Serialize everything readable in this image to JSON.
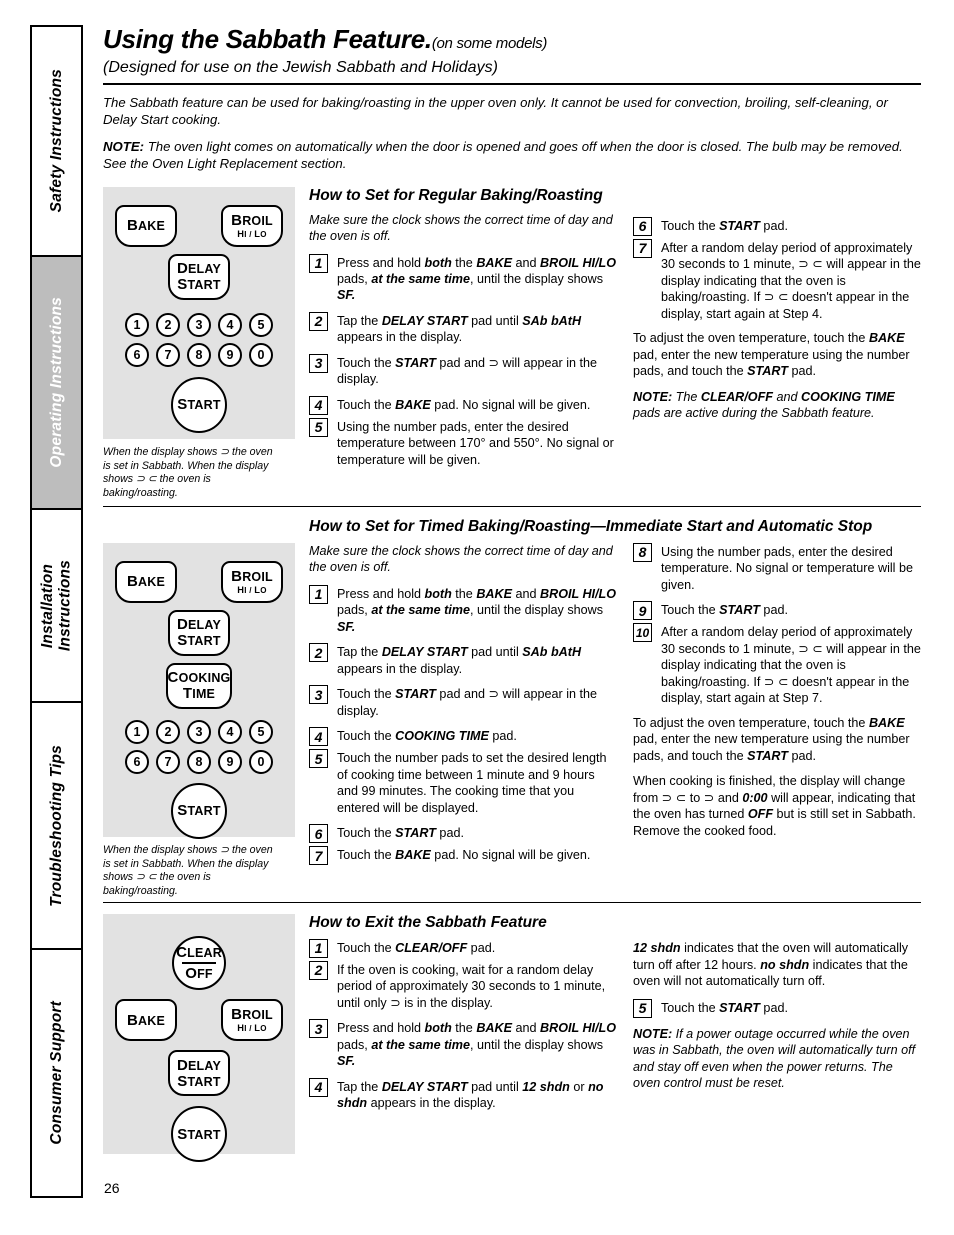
{
  "page_number": "26",
  "sidebar": {
    "tabs": [
      {
        "label": "Safety Instructions",
        "active": false
      },
      {
        "label": "Operating Instructions",
        "active": true
      },
      {
        "label": "Installation\nInstructions",
        "active": false
      },
      {
        "label": "Troubleshooting Tips",
        "active": false
      },
      {
        "label": "Consumer Support",
        "active": false
      }
    ]
  },
  "header": {
    "title": "Using the Sabbath Feature.",
    "title_note": "(on some models)",
    "subtitle": "(Designed for use on the Jewish Sabbath and Holidays)",
    "intro": "The Sabbath feature can be used for baking/roasting in the upper oven only. It cannot be used for convection, broiling, self-cleaning, or Delay Start cooking.",
    "note_label": "NOTE:",
    "note_text": " The oven light comes on automatically when the door is opened and goes off when the door is closed. The bulb may be removed. See the Oven Light Replacement section."
  },
  "diagram_labels": {
    "bake": "Bake",
    "broil": "Broil",
    "broil_sub": "Hi / Lo",
    "delay": "Delay",
    "start_word": "Start",
    "cooking": "Cooking",
    "time": "Time",
    "clear": "Clear",
    "off": "Off",
    "start": "Start",
    "keys_row1": [
      "1",
      "2",
      "3",
      "4",
      "5"
    ],
    "keys_row2": [
      "6",
      "7",
      "8",
      "9",
      "0"
    ]
  },
  "caption": "When the display shows ⊃ the oven is set in Sabbath. When the display shows ⊃ ⊂  the oven is baking/roasting.",
  "section1": {
    "heading": "How to Set for Regular Baking/Roasting",
    "lead": "Make sure the clock shows the correct time of day and the oven is off.",
    "steps": [
      {
        "n": "1",
        "text": "Press and hold <b>both</b> the <b>BAKE</b> and <b>BROIL HI/LO</b> pads, <b>at the same time</b>, until the display shows <b>SF.</b>"
      },
      {
        "n": "2",
        "text": "Tap the <b>DELAY START</b> pad until <b>SAb bAtH</b> appears in the display."
      },
      {
        "n": "3",
        "text": "Touch the <b>START</b> pad and ⊃ will appear in the display."
      },
      {
        "n": "4",
        "text": "Touch the <b>BAKE</b> pad. No signal will be given."
      },
      {
        "n": "5",
        "text": "Using the number pads, enter the desired temperature between 170° and 550°. No signal or temperature will be given."
      }
    ],
    "steps_right": [
      {
        "n": "6",
        "text": "Touch the <b>START</b> pad."
      },
      {
        "n": "7",
        "text": "After a random delay period of approximately 30 seconds to 1 minute, ⊃ ⊂ will appear in the display indicating that the oven is baking/roasting. If ⊃ ⊂ doesn't appear in the display, start again at Step 4."
      }
    ],
    "para_adjust": "To adjust the oven temperature, touch the <b>BAKE</b> pad, enter the new temperature using the number pads, and touch the <b>START</b> pad.",
    "para_note": "<b>NOTE:</b> The <b>CLEAR/OFF</b> and <b>COOKING TIME</b> pads are active during the Sabbath feature."
  },
  "section2": {
    "heading": "How to Set for Timed Baking/Roasting—Immediate Start and Automatic Stop",
    "lead": "Make sure the clock shows the correct time of day and the oven is off.",
    "steps": [
      {
        "n": "1",
        "text": "Press and hold <b>both</b> the <b>BAKE</b> and <b>BROIL HI/LO</b> pads, <b>at the same time</b>, until the display shows <b>SF.</b>"
      },
      {
        "n": "2",
        "text": "Tap the <b>DELAY START</b> pad until <b>SAb bAtH</b> appears in the display."
      },
      {
        "n": "3",
        "text": "Touch the <b>START</b> pad and ⊃ will appear in the display."
      },
      {
        "n": "4",
        "text": "Touch the <b>COOKING TIME</b> pad."
      },
      {
        "n": "5",
        "text": "Touch the number pads to set the desired length of cooking time between 1 minute and 9 hours and 99 minutes. The cooking time that you entered will be displayed."
      },
      {
        "n": "6",
        "text": "Touch the <b>START</b> pad."
      },
      {
        "n": "7",
        "text": "Touch the <b>BAKE</b> pad. No signal will be given."
      }
    ],
    "steps_right": [
      {
        "n": "8",
        "text": "Using the number pads, enter the desired temperature. No signal or temperature will be given."
      },
      {
        "n": "9",
        "text": "Touch the <b>START</b> pad."
      },
      {
        "n": "10",
        "text": "After a random delay period of approximately 30 seconds to 1 minute, ⊃ ⊂ will appear in the display indicating that the oven is baking/roasting. If ⊃ ⊂ doesn't appear in the display, start again at Step 7."
      }
    ],
    "para_adjust": "To adjust the oven temperature, touch the <b>BAKE</b> pad, enter the new temperature using the number pads, and touch the <b>START</b> pad.",
    "para_finish": "When cooking is finished, the display will change from ⊃ ⊂ to ⊃ and <b>0:00</b> will appear, indicating that the oven has turned <b>OFF</b> but is still set in Sabbath. Remove the cooked food."
  },
  "section3": {
    "heading": "How to Exit the Sabbath Feature",
    "steps": [
      {
        "n": "1",
        "text": "Touch the <b>CLEAR/OFF</b> pad."
      },
      {
        "n": "2",
        "text": "If the oven is cooking, wait for a random delay period of approximately 30 seconds to 1 minute, until only ⊃ is in the display."
      },
      {
        "n": "3",
        "text": "Press and hold <b>both</b> the <b>BAKE</b> and <b>BROIL HI/LO</b> pads, <b>at the same time</b>, until the display shows <b>SF.</b>"
      },
      {
        "n": "4",
        "text": "Tap the <b>DELAY START</b> pad until <b>12 shdn</b> or <b>no shdn</b> appears in the display."
      }
    ],
    "para_shdn": "<b>12 shdn</b> indicates that the oven will automatically turn off after 12 hours. <b>no shdn</b> indicates that the oven will not automatically turn off.",
    "steps_right": [
      {
        "n": "5",
        "text": "Touch the <b>START</b> pad."
      }
    ],
    "para_note": "<b>NOTE:</b> If a power outage occurred while the oven was in Sabbath, the oven will automatically turn off and stay off even when the power returns. The oven control must be reset."
  }
}
